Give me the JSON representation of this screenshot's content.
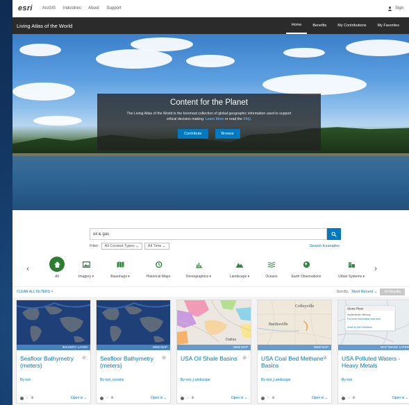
{
  "topbar": {
    "logo": "esri",
    "nav": [
      "ArcGIS",
      "Industries",
      "About",
      "Support"
    ],
    "sign_in": "Sign"
  },
  "navbar": {
    "title": "Living Atlas of the World",
    "links": [
      "Home",
      "Benefits",
      "My Contributions",
      "My Favorites"
    ],
    "active": "Home"
  },
  "hero": {
    "title": "Content for the Planet",
    "desc_a": "The Living Atlas of the World is the foremost collection of global geographic information used to support",
    "desc_b": "critical decision making. ",
    "learn_more": "Learn More",
    "desc_c": " or read the ",
    "faq": "FAQ",
    "desc_d": ".",
    "contribute": "Contribute",
    "browse": "Browse"
  },
  "search": {
    "value": "oil & gas",
    "filter_label": "Filter:",
    "content_type": "All Content Types",
    "time": "All Time",
    "examples": "Search Examples"
  },
  "categories": [
    {
      "label": "All",
      "icon": "home-icon"
    },
    {
      "label": "Imagery ▾",
      "icon": "imagery-icon"
    },
    {
      "label": "Basemaps ▾",
      "icon": "map-icon"
    },
    {
      "label": "Historical Maps",
      "icon": "history-icon"
    },
    {
      "label": "Demographics ▾",
      "icon": "chart-icon"
    },
    {
      "label": "Landscape ▾",
      "icon": "mountain-icon"
    },
    {
      "label": "Oceans",
      "icon": "waves-icon"
    },
    {
      "label": "Earth Observations",
      "icon": "globe-icon"
    },
    {
      "label": "Urban Systems ▾",
      "icon": "city-icon"
    }
  ],
  "filters": {
    "clear": "CLEAR ALL FILTERS ×",
    "sort_label": "Sort By:",
    "sort_value": "Most Recent",
    "results": "10 Results"
  },
  "cards": [
    {
      "title": "Seafloor Bathymetry (meters)",
      "by": "By esri",
      "type": "IMAGERY LAYER",
      "open": "Open in",
      "thumb": "globe"
    },
    {
      "title": "Seafloor Bathymetry (meters)",
      "by": "By esri_oceans",
      "type": "WEB MAP",
      "open": "Open in",
      "thumb": "globe"
    },
    {
      "title": "USA Oil Shale Basins",
      "by": "By esri_Landscape",
      "type": "WEB MAP",
      "open": "Open in",
      "thumb": "shale",
      "place": "Dallas"
    },
    {
      "title": "USA Coal Bed Methane Basins",
      "by": "By esri_Landscape",
      "type": "WEB MAP",
      "open": "Open in",
      "thumb": "coal",
      "place_a": "Coffeyville",
      "place_b": "Bartlesville"
    },
    {
      "title": "USA Polluted Waters - Heavy Metals",
      "by": "By esri",
      "type": "MAP IMAGE LAYER",
      "open": "Open in",
      "thumb": "polluted",
      "popup_title": "Stone River",
      "popup_line1": "Impairments: Mercury",
      "popup_line2": "For more information click here.",
      "popup_line3": "Zoom to   Get Directions"
    }
  ],
  "colors": {
    "accent": "#0079c1",
    "dark_nav": "#2b2b2b",
    "category_green": "#2e8540"
  }
}
